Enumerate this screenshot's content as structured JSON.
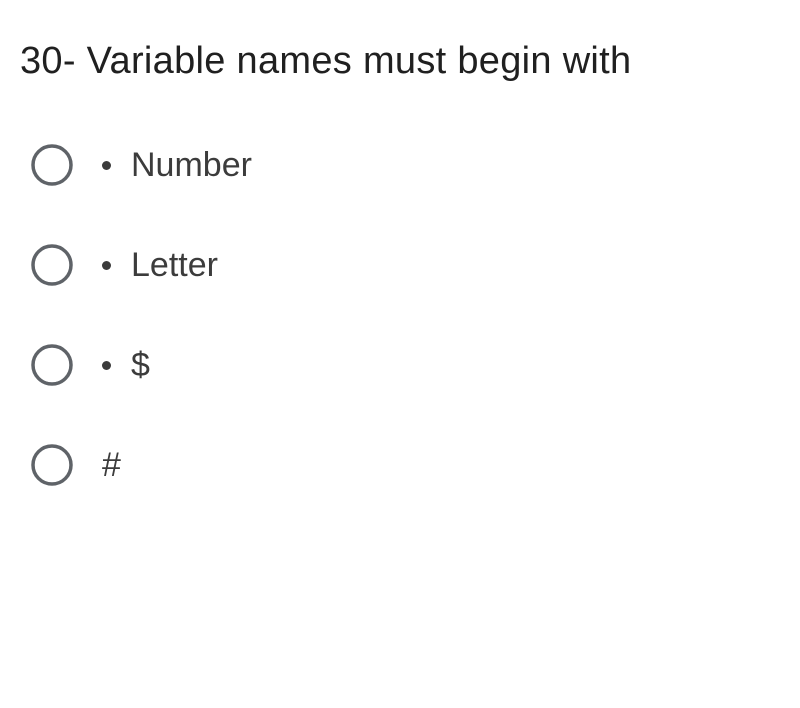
{
  "question": {
    "text": "30- Variable names must begin with"
  },
  "options": [
    {
      "label": "Number",
      "has_bullet": true
    },
    {
      "label": "Letter",
      "has_bullet": true
    },
    {
      "label": "$",
      "has_bullet": true
    },
    {
      "label": "#",
      "has_bullet": false
    }
  ]
}
